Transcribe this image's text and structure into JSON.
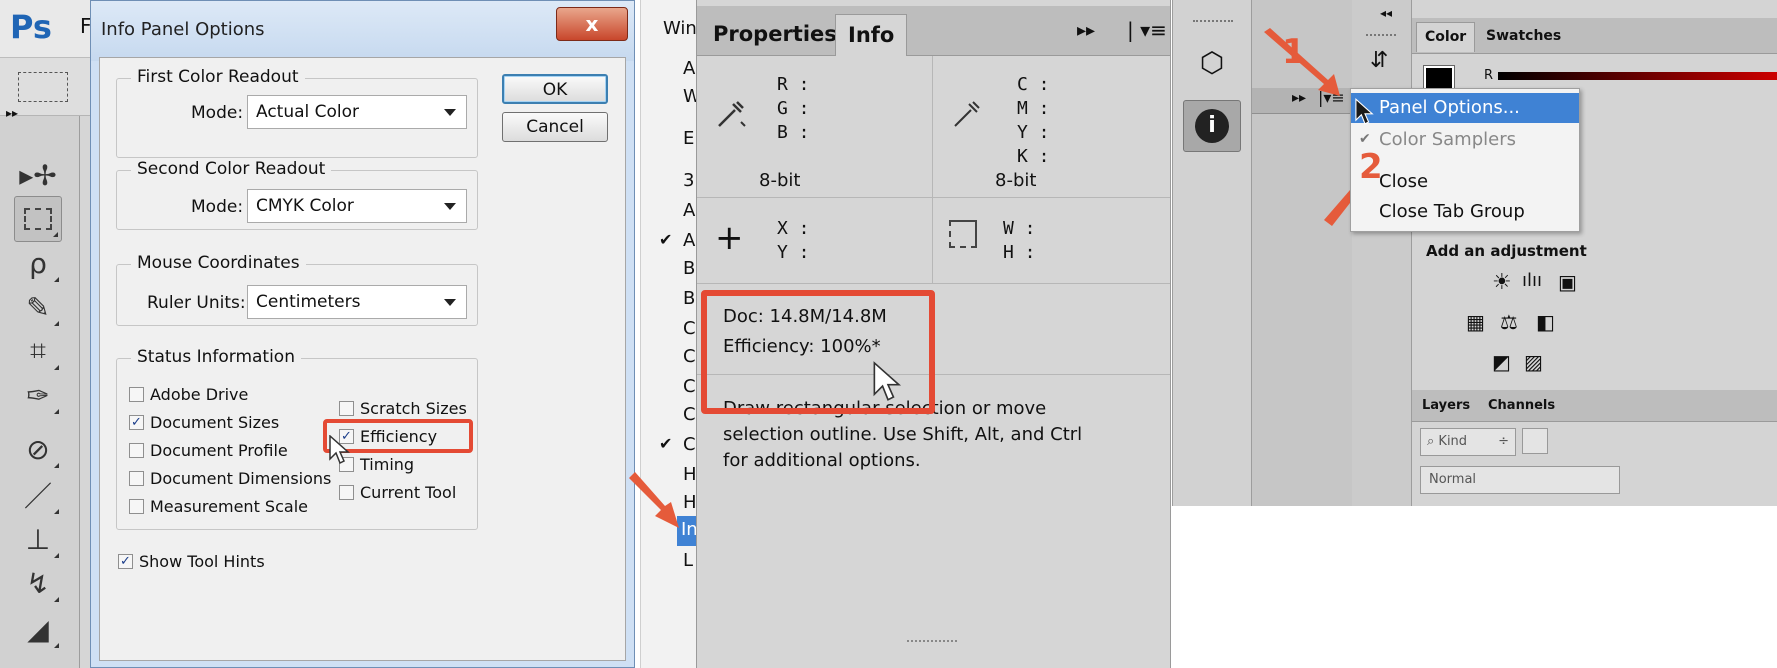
{
  "ps": {
    "logo": "Ps",
    "menu_f": "F"
  },
  "dialog": {
    "title": "Info Panel Options",
    "close_glyph": "x",
    "ok_label": "OK",
    "cancel_label": "Cancel",
    "first_readout": {
      "legend": "First Color Readout",
      "mode_label": "Mode:",
      "mode_value": "Actual Color"
    },
    "second_readout": {
      "legend": "Second Color Readout",
      "mode_label": "Mode:",
      "mode_value": "CMYK Color"
    },
    "mouse": {
      "legend": "Mouse Coordinates",
      "units_label": "Ruler Units:",
      "units_value": "Centimeters"
    },
    "status": {
      "legend": "Status Information",
      "items": [
        {
          "label": "Adobe Drive",
          "checked": false
        },
        {
          "label": "Document Sizes",
          "checked": true
        },
        {
          "label": "Document Profile",
          "checked": false
        },
        {
          "label": "Document Dimensions",
          "checked": false
        },
        {
          "label": "Measurement Scale",
          "checked": false
        },
        {
          "label": "Scratch Sizes",
          "checked": false
        },
        {
          "label": "Efficiency",
          "checked": true
        },
        {
          "label": "Timing",
          "checked": false
        },
        {
          "label": "Current Tool",
          "checked": false
        }
      ]
    },
    "show_tool_hints": {
      "label": "Show Tool Hints",
      "checked": true
    }
  },
  "window_menu": {
    "header": "Win",
    "letters": [
      "A",
      "W",
      "E",
      "3",
      "A",
      "A",
      "B",
      "B",
      "C",
      "C",
      "C",
      "C",
      "C",
      "H",
      "H",
      "In",
      "L"
    ],
    "checkmark": "✔"
  },
  "info_panel": {
    "tabs": [
      "Properties",
      "Info"
    ],
    "rgb": {
      "r": "R :",
      "g": "G :",
      "b": "B :",
      "bit": "8-bit"
    },
    "cmyk": {
      "c": "C :",
      "m": "M :",
      "y": "Y :",
      "k": "K :",
      "bit": "8-bit"
    },
    "xy": {
      "x": "X :",
      "y": "Y :"
    },
    "wh": {
      "w": "W :",
      "h": "H :"
    },
    "doc": "Doc: 14.8M/14.8M",
    "efficiency": "Efficiency: 100%*",
    "hint_lines": [
      "Draw rectangular selection or move",
      "selection outline.  Use Shift, Alt, and Ctrl",
      "for additional options."
    ]
  },
  "flyout": {
    "items": [
      "Panel Options...",
      "Color Samplers",
      "Close",
      "Close Tab Group"
    ],
    "checkmark": "✔"
  },
  "annotations": {
    "step1": "1",
    "step2": "2"
  },
  "right_panel": {
    "tabs": [
      "Color",
      "Swatches"
    ],
    "r_label": "R",
    "adjustment_title": "Add an adjustment",
    "layer_tabs": [
      "Layers",
      "Channels"
    ],
    "kind_label": "Kind",
    "blend_mode": "Normal"
  },
  "colors": {
    "accent": "#e44a34",
    "highlight": "#3f82d4",
    "ps_blue": "#1f65b5"
  }
}
